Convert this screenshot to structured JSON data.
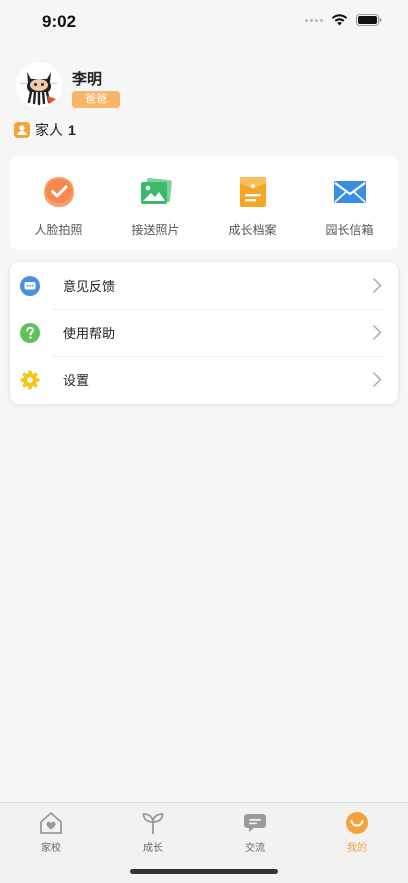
{
  "status_bar": {
    "time": "9:02"
  },
  "profile": {
    "name": "李明",
    "role": "爸爸"
  },
  "family": {
    "label": "家人",
    "count": "1"
  },
  "quick_actions": [
    {
      "label": "人脸拍照",
      "icon": "face-photo-icon",
      "color": "#f7874e"
    },
    {
      "label": "接送照片",
      "icon": "pickup-photo-icon",
      "color": "#3cb96a"
    },
    {
      "label": "成长档案",
      "icon": "growth-file-icon",
      "color": "#f5a623"
    },
    {
      "label": "园长信箱",
      "icon": "mailbox-icon",
      "color": "#3a8ee6"
    }
  ],
  "menu": [
    {
      "label": "意见反馈",
      "icon": "feedback-icon",
      "color": "#4a90e2"
    },
    {
      "label": "使用帮助",
      "icon": "help-icon",
      "color": "#5cc25c"
    },
    {
      "label": "设置",
      "icon": "settings-icon",
      "color": "#f5c518"
    }
  ],
  "tabs": [
    {
      "label": "家校",
      "icon": "home-school-icon",
      "active": false
    },
    {
      "label": "成长",
      "icon": "sprout-icon",
      "active": false
    },
    {
      "label": "交流",
      "icon": "chat-icon",
      "active": false
    },
    {
      "label": "我的",
      "icon": "smile-icon",
      "active": true
    }
  ],
  "colors": {
    "accent": "#f5a23c",
    "badge": "#f7b769"
  }
}
